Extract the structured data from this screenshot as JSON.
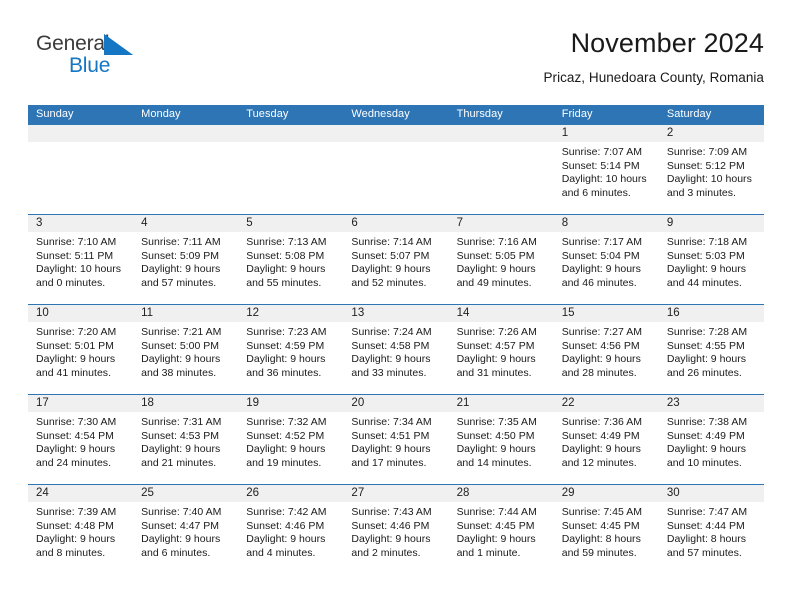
{
  "brand": {
    "name_part1": "General",
    "name_part2": "Blue",
    "triangle_icon": "triangle-icon",
    "color_dark": "#3b3b3b",
    "color_blue": "#1577c4"
  },
  "header": {
    "title": "November 2024",
    "subtitle": "Pricaz, Hunedoara County, Romania"
  },
  "theme": {
    "header_blue": "#2e75b6",
    "daynum_band": "#f0f0f0",
    "text": "#1a1a1a"
  },
  "weekday_headers": [
    "Sunday",
    "Monday",
    "Tuesday",
    "Wednesday",
    "Thursday",
    "Friday",
    "Saturday"
  ],
  "weeks": [
    [
      {
        "day": "",
        "empty": true
      },
      {
        "day": "",
        "empty": true
      },
      {
        "day": "",
        "empty": true
      },
      {
        "day": "",
        "empty": true
      },
      {
        "day": "",
        "empty": true
      },
      {
        "day": "1",
        "sunrise": "Sunrise: 7:07 AM",
        "sunset": "Sunset: 5:14 PM",
        "daylight": "Daylight: 10 hours and 6 minutes."
      },
      {
        "day": "2",
        "sunrise": "Sunrise: 7:09 AM",
        "sunset": "Sunset: 5:12 PM",
        "daylight": "Daylight: 10 hours and 3 minutes."
      }
    ],
    [
      {
        "day": "3",
        "sunrise": "Sunrise: 7:10 AM",
        "sunset": "Sunset: 5:11 PM",
        "daylight": "Daylight: 10 hours and 0 minutes."
      },
      {
        "day": "4",
        "sunrise": "Sunrise: 7:11 AM",
        "sunset": "Sunset: 5:09 PM",
        "daylight": "Daylight: 9 hours and 57 minutes."
      },
      {
        "day": "5",
        "sunrise": "Sunrise: 7:13 AM",
        "sunset": "Sunset: 5:08 PM",
        "daylight": "Daylight: 9 hours and 55 minutes."
      },
      {
        "day": "6",
        "sunrise": "Sunrise: 7:14 AM",
        "sunset": "Sunset: 5:07 PM",
        "daylight": "Daylight: 9 hours and 52 minutes."
      },
      {
        "day": "7",
        "sunrise": "Sunrise: 7:16 AM",
        "sunset": "Sunset: 5:05 PM",
        "daylight": "Daylight: 9 hours and 49 minutes."
      },
      {
        "day": "8",
        "sunrise": "Sunrise: 7:17 AM",
        "sunset": "Sunset: 5:04 PM",
        "daylight": "Daylight: 9 hours and 46 minutes."
      },
      {
        "day": "9",
        "sunrise": "Sunrise: 7:18 AM",
        "sunset": "Sunset: 5:03 PM",
        "daylight": "Daylight: 9 hours and 44 minutes."
      }
    ],
    [
      {
        "day": "10",
        "sunrise": "Sunrise: 7:20 AM",
        "sunset": "Sunset: 5:01 PM",
        "daylight": "Daylight: 9 hours and 41 minutes."
      },
      {
        "day": "11",
        "sunrise": "Sunrise: 7:21 AM",
        "sunset": "Sunset: 5:00 PM",
        "daylight": "Daylight: 9 hours and 38 minutes."
      },
      {
        "day": "12",
        "sunrise": "Sunrise: 7:23 AM",
        "sunset": "Sunset: 4:59 PM",
        "daylight": "Daylight: 9 hours and 36 minutes."
      },
      {
        "day": "13",
        "sunrise": "Sunrise: 7:24 AM",
        "sunset": "Sunset: 4:58 PM",
        "daylight": "Daylight: 9 hours and 33 minutes."
      },
      {
        "day": "14",
        "sunrise": "Sunrise: 7:26 AM",
        "sunset": "Sunset: 4:57 PM",
        "daylight": "Daylight: 9 hours and 31 minutes."
      },
      {
        "day": "15",
        "sunrise": "Sunrise: 7:27 AM",
        "sunset": "Sunset: 4:56 PM",
        "daylight": "Daylight: 9 hours and 28 minutes."
      },
      {
        "day": "16",
        "sunrise": "Sunrise: 7:28 AM",
        "sunset": "Sunset: 4:55 PM",
        "daylight": "Daylight: 9 hours and 26 minutes."
      }
    ],
    [
      {
        "day": "17",
        "sunrise": "Sunrise: 7:30 AM",
        "sunset": "Sunset: 4:54 PM",
        "daylight": "Daylight: 9 hours and 24 minutes."
      },
      {
        "day": "18",
        "sunrise": "Sunrise: 7:31 AM",
        "sunset": "Sunset: 4:53 PM",
        "daylight": "Daylight: 9 hours and 21 minutes."
      },
      {
        "day": "19",
        "sunrise": "Sunrise: 7:32 AM",
        "sunset": "Sunset: 4:52 PM",
        "daylight": "Daylight: 9 hours and 19 minutes."
      },
      {
        "day": "20",
        "sunrise": "Sunrise: 7:34 AM",
        "sunset": "Sunset: 4:51 PM",
        "daylight": "Daylight: 9 hours and 17 minutes."
      },
      {
        "day": "21",
        "sunrise": "Sunrise: 7:35 AM",
        "sunset": "Sunset: 4:50 PM",
        "daylight": "Daylight: 9 hours and 14 minutes."
      },
      {
        "day": "22",
        "sunrise": "Sunrise: 7:36 AM",
        "sunset": "Sunset: 4:49 PM",
        "daylight": "Daylight: 9 hours and 12 minutes."
      },
      {
        "day": "23",
        "sunrise": "Sunrise: 7:38 AM",
        "sunset": "Sunset: 4:49 PM",
        "daylight": "Daylight: 9 hours and 10 minutes."
      }
    ],
    [
      {
        "day": "24",
        "sunrise": "Sunrise: 7:39 AM",
        "sunset": "Sunset: 4:48 PM",
        "daylight": "Daylight: 9 hours and 8 minutes."
      },
      {
        "day": "25",
        "sunrise": "Sunrise: 7:40 AM",
        "sunset": "Sunset: 4:47 PM",
        "daylight": "Daylight: 9 hours and 6 minutes."
      },
      {
        "day": "26",
        "sunrise": "Sunrise: 7:42 AM",
        "sunset": "Sunset: 4:46 PM",
        "daylight": "Daylight: 9 hours and 4 minutes."
      },
      {
        "day": "27",
        "sunrise": "Sunrise: 7:43 AM",
        "sunset": "Sunset: 4:46 PM",
        "daylight": "Daylight: 9 hours and 2 minutes."
      },
      {
        "day": "28",
        "sunrise": "Sunrise: 7:44 AM",
        "sunset": "Sunset: 4:45 PM",
        "daylight": "Daylight: 9 hours and 1 minute."
      },
      {
        "day": "29",
        "sunrise": "Sunrise: 7:45 AM",
        "sunset": "Sunset: 4:45 PM",
        "daylight": "Daylight: 8 hours and 59 minutes."
      },
      {
        "day": "30",
        "sunrise": "Sunrise: 7:47 AM",
        "sunset": "Sunset: 4:44 PM",
        "daylight": "Daylight: 8 hours and 57 minutes."
      }
    ]
  ]
}
